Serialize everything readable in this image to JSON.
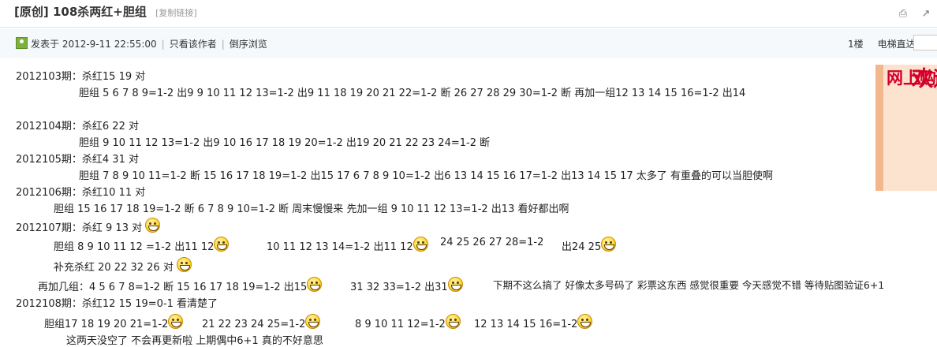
{
  "header": {
    "tag": "[原创]",
    "title": "108杀两红+胆组",
    "copy_link": "[复制链接]"
  },
  "meta": {
    "posted_label": "发表于 2012-9-11 22:55:00",
    "only_author": "只看该作者",
    "reverse_order": "倒序浏览",
    "floor": "1楼",
    "jump_label": "电梯直达"
  },
  "ad": {
    "left_text": "网上购彩已恢复",
    "right_text": "欢迎入场 ▶",
    "brand_color": "#d4002a"
  },
  "icons": {
    "print": "print-icon",
    "share": "share-icon",
    "emoticon": "grin-emoticon"
  },
  "post": {
    "l1": "2012103期：杀红15 19  对",
    "l2": "胆组 5 6 7 8 9=1-2  出9     9 10 11 12 13=1-2  出9 11      18 19 20 21 22=1-2   断    26 27 28 29 30=1-2  断    再加一组12 13 14 15 16=1-2   出14",
    "l3": "2012104期：杀红6 22  对",
    "l4": "胆组 9 10 11 12 13=1-2   出9  10     16 17 18 19 20=1-2   出19     20 21 22 23 24=1-2      断",
    "l5": "2012105期：杀红4  31  对",
    "l6": "胆组  7 8 9 10 11=1-2   断     15 16 17 18 19=1-2   出15 17    6 7 8 9 10=1-2   出6      13 14 15 16 17=1-2  出13 14 15 17  太多了   有重叠的可以当胆使啊",
    "l7": "2012106期：杀红10 11  对",
    "l8": "胆组 15 16 17 18 19=1-2  断        6 7 8 9 10=1-2  断  周末慢慢来    先加一组 9 10 11 12 13=1-2  出13     看好都出啊",
    "l9": "2012107期：杀红  9  13 对",
    "l10a": "胆组   8 9 10 11 12 =1-2   出11 12",
    "l10b": "10 11 12  13 14=1-2  出11 12",
    "l10c": "24 25 26 27 28=1-2",
    "l10d": "出24 25",
    "l11": "补充杀红  20 22 32  26  对",
    "l12a": "再加几组：4 5 6 7 8=1-2    断    15 16 17 18 19=1-2 出15",
    "l12b": "31 32 33=1-2     出31",
    "l12c": "下期不这么搞了 好像太多号码了   彩票这东西 感觉很重要   今天感觉不错  等待贴图验证6+1",
    "l13": "2012108期：杀红12 15  19=0-1    看清楚了",
    "l14a": "胆组17 18 19 20 21=1-2",
    "l14b": "21  22 23 24 25=1-2",
    "l14c": "8 9 10 11 12=1-2",
    "l14d": "12 13 14 15 16=1-2",
    "l15": "这两天没空了 不会再更新啦  上期偶中6+1      真的不好意思"
  }
}
